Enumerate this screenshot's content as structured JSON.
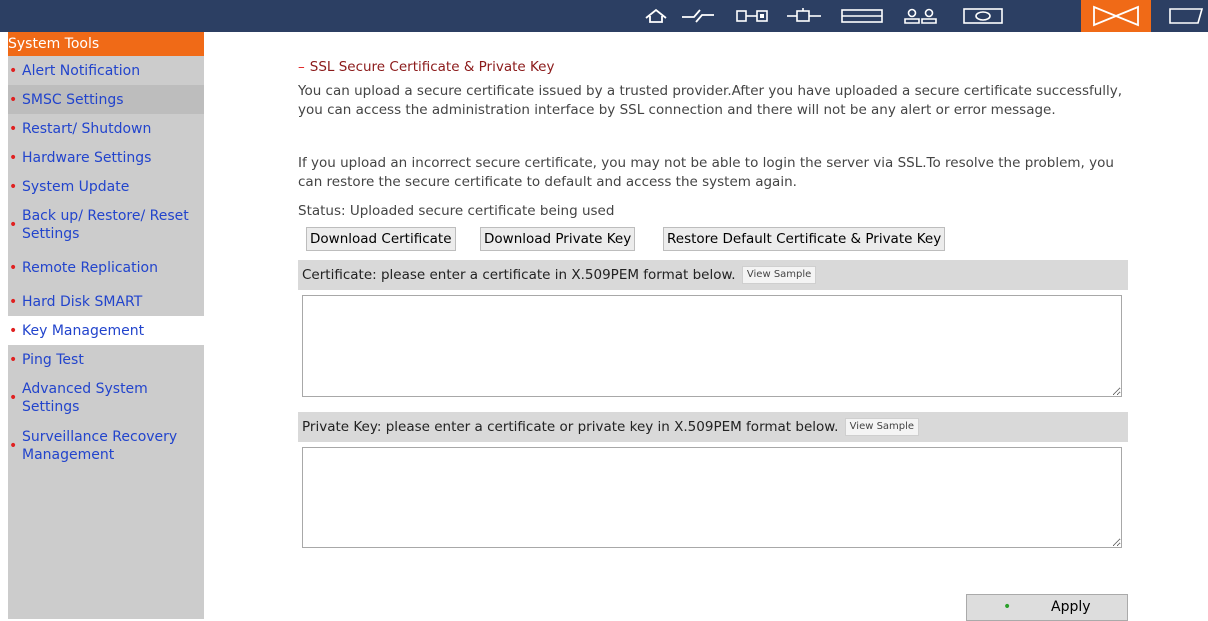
{
  "topbar": {
    "icons": [
      "home-icon",
      "network-icon",
      "device-icon",
      "plug-icon",
      "disk-icon",
      "users-icon",
      "monitor-icon",
      "tools-icon",
      "log-icon"
    ],
    "active_icon": "tools-icon",
    "colors": {
      "background": "#2c3f63",
      "active": "#f06a17",
      "icon": "#ffffff"
    }
  },
  "sidebar": {
    "title": "System Tools",
    "items": [
      {
        "label": "Alert Notification"
      },
      {
        "label": "SMSC Settings"
      },
      {
        "label": "Restart/ Shutdown"
      },
      {
        "label": "Hardware Settings"
      },
      {
        "label": "System Update"
      },
      {
        "label": "Back up/ Restore/ Reset Settings"
      },
      {
        "label": "Remote Replication"
      },
      {
        "label": "Hard Disk SMART"
      },
      {
        "label": "Key Management"
      },
      {
        "label": "Ping Test"
      },
      {
        "label": "Advanced System Settings"
      },
      {
        "label": "Surveillance Recovery Management"
      }
    ],
    "selected": "Key Management",
    "colors": {
      "background": "#cccccc",
      "title_bg": "#f06a17",
      "link": "#2244cc",
      "bullet": "#e02020"
    }
  },
  "main": {
    "section_title": "SSL Secure Certificate & Private Key",
    "description_1": "You can upload a secure certificate issued by a trusted provider.After you have uploaded a secure certificate successfully, you can access the administration interface by SSL connection and there will not be any alert or error message.",
    "description_2": "If you upload an incorrect secure certificate, you may not be able to login the server via SSL.To resolve the problem, you can restore the secure certificate to default and access the system again.",
    "status": "Status: Uploaded secure certificate being used",
    "buttons": {
      "download_certificate": "Download Certificate",
      "download_private_key": "Download Private Key",
      "restore_default": "Restore Default Certificate & Private Key"
    },
    "certificate": {
      "label": "Certificate: please enter a certificate in X.509PEM format below.",
      "view_sample": "View Sample",
      "value": ""
    },
    "private_key": {
      "label": "Private Key: please enter a certificate or private key in X.509PEM format below.",
      "view_sample": "View Sample",
      "value": ""
    },
    "apply_label": "Apply"
  }
}
